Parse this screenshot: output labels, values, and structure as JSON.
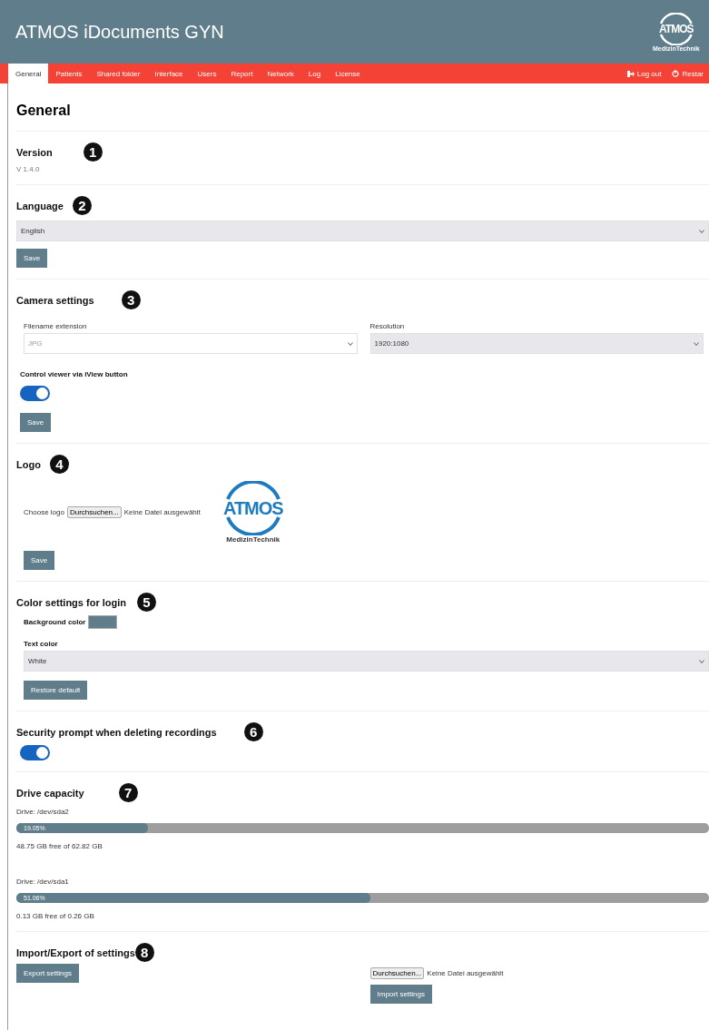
{
  "app": {
    "title": "ATMOS iDocuments GYN",
    "logo": {
      "mark": "ATMOS",
      "subtitle": "MedizinTechnik"
    }
  },
  "nav": {
    "tabs": [
      {
        "label": "General",
        "selected": true
      },
      {
        "label": "Patients",
        "selected": false
      },
      {
        "label": "Shared folder",
        "selected": false
      },
      {
        "label": "Interface",
        "selected": false
      },
      {
        "label": "Users",
        "selected": false
      },
      {
        "label": "Report",
        "selected": false
      },
      {
        "label": "Network",
        "selected": false
      },
      {
        "label": "Log",
        "selected": false
      },
      {
        "label": "License",
        "selected": false
      }
    ],
    "actions": [
      {
        "kind": "logout",
        "label": "Log out"
      },
      {
        "kind": "restart",
        "label": "Restar"
      }
    ]
  },
  "page_title": "General",
  "version": {
    "heading": "Version",
    "callout": "1",
    "value": "V 1.4.0"
  },
  "language": {
    "heading": "Language",
    "callout": "2",
    "value": "English",
    "button": "Save"
  },
  "camera": {
    "heading": "Camera settings",
    "callout": "3",
    "fields": [
      {
        "label": "Filename extension",
        "value": "JPG",
        "disabled": true
      },
      {
        "label": "Resolution",
        "value": "1920:1080",
        "disabled": false
      }
    ],
    "toggle_label": "Control viewer via iView button",
    "toggle_on": true,
    "button": "Save"
  },
  "logo": {
    "heading": "Logo",
    "callout": "4",
    "label": "Choose logo",
    "browse": "Durchsuchen...",
    "file_status": "Keine Datei ausgewählt",
    "preview": {
      "mark": "ATMOS",
      "subtitle": "MedizinTechnik"
    },
    "button": "Save"
  },
  "colors": {
    "heading": "Color settings for login",
    "callout": "5",
    "background_label": "Background color",
    "text_label": "Text color",
    "text_value": "White",
    "button": "Restore default"
  },
  "security": {
    "heading": "Security prompt when deleting recordings",
    "callout": "6",
    "on": true
  },
  "drives": {
    "heading": "Drive capacity",
    "callout": "7",
    "items": [
      {
        "name": "Drive: /dev/sda2",
        "level": 0.1905,
        "reading": "19.05%",
        "free": "48.75 GB free of 62.82 GB"
      },
      {
        "name": "Drive: /dev/sda1",
        "level": 0.5106,
        "reading": "51.06%",
        "free": "0.13 GB free of 0.26 GB"
      }
    ]
  },
  "import_export": {
    "heading": "Import/Export of settings",
    "callout": "8",
    "export_button": "Export settings",
    "browse": "Durchsuchen...",
    "file_status": "Keine Datei ausgewählt",
    "import_button": "Import settings"
  }
}
